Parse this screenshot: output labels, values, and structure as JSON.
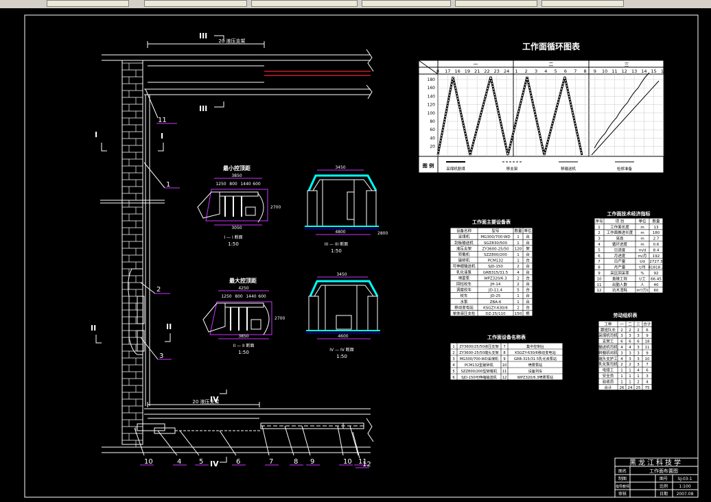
{
  "toolbar": {
    "tabs": [
      {
        "label": ""
      },
      {
        "label": ""
      },
      {
        "label": ""
      },
      {
        "label": ""
      },
      {
        "label": ""
      },
      {
        "label": ""
      }
    ]
  },
  "section_markers": {
    "III": "III",
    "I": "I",
    "II": "II",
    "IV": "IV"
  },
  "support_label_top": "20 液压支架",
  "support_label_bottom": "20 液压支架",
  "callouts": [
    "1",
    "2",
    "3",
    "4",
    "5",
    "6",
    "7",
    "8",
    "9",
    "10",
    "11",
    "12",
    "10"
  ],
  "sections": {
    "min_title": "最小控顶距",
    "max_title": "最大控顶距",
    "sec1_label": "I — I  断面",
    "sec2_label": "II — II  断面",
    "sec3_label": "III — III  断面",
    "sec4_label": "IV — IV  断面",
    "scale1": "1:50",
    "scale2": "1:50",
    "scale3": "1:50",
    "scale4": "1:50",
    "dim_min_top": "3850",
    "dim_min_parts": [
      "1250",
      "800",
      "1440",
      "600"
    ],
    "dim_min_bottom": "3050",
    "dim_max_top": "4250",
    "dim_max_parts": [
      "1250",
      "800",
      "1440",
      "600"
    ],
    "dim_max_bottom": "3850",
    "dim_height": "2700",
    "dim_sec3_top": "3450",
    "dim_sec3_bottom": "4800",
    "dim_sec4_top": "3450",
    "dim_sec4_bottom": "4600",
    "dim_side": "2800"
  },
  "cycle": {
    "title": "工作面循环图表",
    "shifts": [
      "一",
      "二",
      "三"
    ],
    "hours": [
      "8",
      "17",
      "16",
      "19",
      "21",
      "22",
      "23",
      "24",
      "1",
      "2",
      "3",
      "4",
      "5",
      "6",
      "7",
      "8",
      "9",
      "10",
      "11",
      "12",
      "13",
      "14",
      "15",
      "16"
    ],
    "yticks": [
      "180",
      "160",
      "140",
      "120",
      "100",
      "80",
      "60",
      "40",
      "20"
    ],
    "legend_label": "图  例",
    "legend_items": [
      "采煤机割煤",
      "移支架",
      "移输送机",
      "检修准备"
    ]
  },
  "equipment_table": {
    "title": "工作面主要设备表",
    "headers": [
      "设备名称",
      "型号",
      "数量",
      "单位"
    ],
    "rows": [
      [
        "采煤机",
        "MG300/700-WD",
        "1",
        "台"
      ],
      [
        "刮板输送机",
        "SGZ830/500",
        "1",
        "台"
      ],
      [
        "液压支架",
        "ZY3600-25/50",
        "120",
        "架"
      ],
      [
        "转载机",
        "SZZ800/200",
        "1",
        "台"
      ],
      [
        "破碎机",
        "PCM132",
        "1",
        "台"
      ],
      [
        "可伸缩输送机",
        "SJD-150",
        "2",
        "台"
      ],
      [
        "乳化液泵",
        "GRB315/31.5",
        "4",
        "台"
      ],
      [
        "喷雾泵",
        "WPZ320/6.3",
        "2",
        "台"
      ],
      [
        "回柱绞车",
        "JH-14",
        "2",
        "台"
      ],
      [
        "调度绞车",
        "JD-11.4",
        "5",
        "台"
      ],
      [
        "绞车",
        "JD-25",
        "1",
        "台"
      ],
      [
        "水泵",
        "ZBA-6",
        "1",
        "台"
      ],
      [
        "移动变电站",
        "KSGZY-630/6",
        "2",
        "台"
      ],
      [
        "单体液压支柱",
        "DZ-25/110",
        "150",
        "根"
      ]
    ]
  },
  "tech_table": {
    "title": "工作面技术经济指标",
    "headers": [
      "序号",
      "项  目",
      "单位",
      "数量"
    ],
    "rows": [
      [
        "1",
        "工作面长度",
        "m",
        "13"
      ],
      [
        "2",
        "工作面推进长度",
        "m",
        "180"
      ],
      [
        "3",
        "采高",
        "m",
        "2.7"
      ],
      [
        "4",
        "循环进度",
        "m",
        "0.6"
      ],
      [
        "5",
        "日进度",
        "m/d",
        "8.4"
      ],
      [
        "6",
        "月进度",
        "m/月",
        "192"
      ],
      [
        "7",
        "日产量",
        "t/d",
        "2727.3"
      ],
      [
        "8",
        "月产量",
        "t/月",
        "81818.2"
      ],
      [
        "9",
        "采区回采率",
        "%",
        "92"
      ],
      [
        "10",
        "直接工效",
        "t/工",
        "66.45"
      ],
      [
        "11",
        "出勤人数",
        "人",
        "40"
      ],
      [
        "12",
        "坑木消耗",
        "m³/万t",
        "60"
      ]
    ]
  },
  "labor_table": {
    "title": "劳动组织表",
    "headers": [
      "工种",
      "一",
      "二",
      "三",
      "合计"
    ],
    "rows": [
      [
        "跟班队长",
        "2",
        "2",
        "2",
        "6"
      ],
      [
        "采煤机司机",
        "3",
        "3",
        "3",
        "9"
      ],
      [
        "支架工",
        "6",
        "6",
        "6",
        "18"
      ],
      [
        "输送机司机",
        "4",
        "4",
        "3",
        "11"
      ],
      [
        "转载机司机",
        "3",
        "3",
        "3",
        "9"
      ],
      [
        "端头支护工",
        "4",
        "3",
        "3",
        "10"
      ],
      [
        "乳化泵司机",
        "2",
        "2",
        "3",
        "7"
      ],
      [
        "电钳工",
        "1",
        "1",
        "4",
        "6"
      ],
      [
        "安全员",
        "1",
        "1",
        "1",
        "3"
      ],
      [
        "验收员",
        "1",
        "1",
        "2",
        "4"
      ],
      [
        "合计",
        "26",
        "24",
        "25",
        "75"
      ]
    ]
  },
  "device_names_table": {
    "title": "工作面设备名称表",
    "rows": [
      [
        "1",
        "ZY3600/25/50液压支架",
        "7",
        "集中控制台"
      ],
      [
        "2",
        "ZY3600-25/50端头支架",
        "8",
        "KSGZY-630/6移动变电站"
      ],
      [
        "3",
        "MG300/700-WD采煤机",
        "9",
        "GRB-315/31.5乳化液泵站"
      ],
      [
        "4",
        "PCM132型破碎机",
        "10",
        "喷雾泵站"
      ],
      [
        "5",
        "SZZ800/200型转载机",
        "11",
        "设备列车"
      ],
      [
        "6",
        "SJD-150可伸缩输送机",
        "12",
        "WPZ320/6.3喷雾泵站"
      ]
    ]
  },
  "title_block": {
    "school": "黑龙江科技学",
    "drawing_name": "工作面布置图",
    "labels": [
      "图名",
      "制图",
      "指导教师",
      "审核"
    ],
    "right_labels": [
      "图号",
      "比例",
      "日期"
    ],
    "values": [
      "SJ-03-1",
      "1:100",
      "2007.08"
    ]
  }
}
